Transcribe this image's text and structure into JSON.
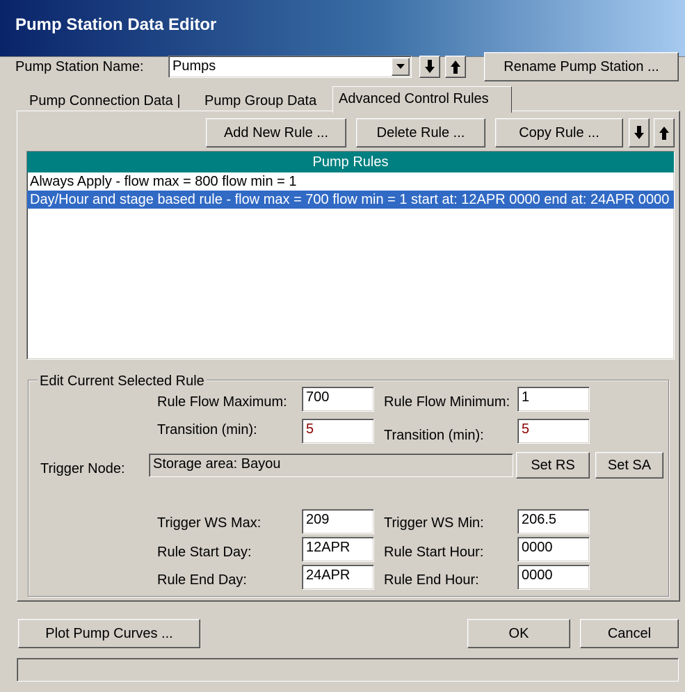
{
  "window": {
    "title": "Pump Station Data Editor"
  },
  "station": {
    "name_label": "Pump Station Name:",
    "name_value": "Pumps",
    "rename_button": "Rename Pump Station ..."
  },
  "tabs": [
    {
      "label": "Pump Connection Data"
    },
    {
      "label": "Pump Group Data"
    },
    {
      "label": "Advanced Control Rules"
    }
  ],
  "toolbar": {
    "add_rule": "Add New Rule ...",
    "delete_rule": "Delete Rule ...",
    "copy_rule": "Copy Rule ..."
  },
  "rules_list": {
    "header": "Pump Rules",
    "header_color": "#008080",
    "items": [
      "Always Apply - flow max = 800 flow min = 1",
      "Day/Hour and stage based rule - flow max = 700 flow min = 1 start at: 12APR 0000 end at: 24APR 0000"
    ],
    "selected_index": 1
  },
  "edit_rule": {
    "group_label": "Edit Current Selected Rule",
    "flow_max_label": "Rule Flow Maximum:",
    "flow_max_value": "700",
    "flow_min_label": "Rule Flow Minimum:",
    "flow_min_value": "1",
    "transition_max_label": "Transition (min):",
    "transition_max_value": "5",
    "transition_min_label": "Transition (min):",
    "transition_min_value": "5",
    "trigger_node_label": "Trigger Node:",
    "trigger_node_value": "Storage area: Bayou",
    "set_rs_button": "Set RS",
    "set_sa_button": "Set SA",
    "trigger_ws_max_label": "Trigger WS Max:",
    "trigger_ws_max_value": "209",
    "trigger_ws_min_label": "Trigger WS Min:",
    "trigger_ws_min_value": "206.5",
    "start_day_label": "Rule Start Day:",
    "start_day_value": "12APR",
    "start_hour_label": "Rule Start Hour:",
    "start_hour_value": "0000",
    "end_day_label": "Rule End Day:",
    "end_day_value": "24APR",
    "end_hour_label": "Rule End Hour:",
    "end_hour_value": "0000"
  },
  "footer": {
    "plot_button": "Plot Pump Curves ...",
    "ok_button": "OK",
    "cancel_button": "Cancel",
    "status_text": ""
  }
}
